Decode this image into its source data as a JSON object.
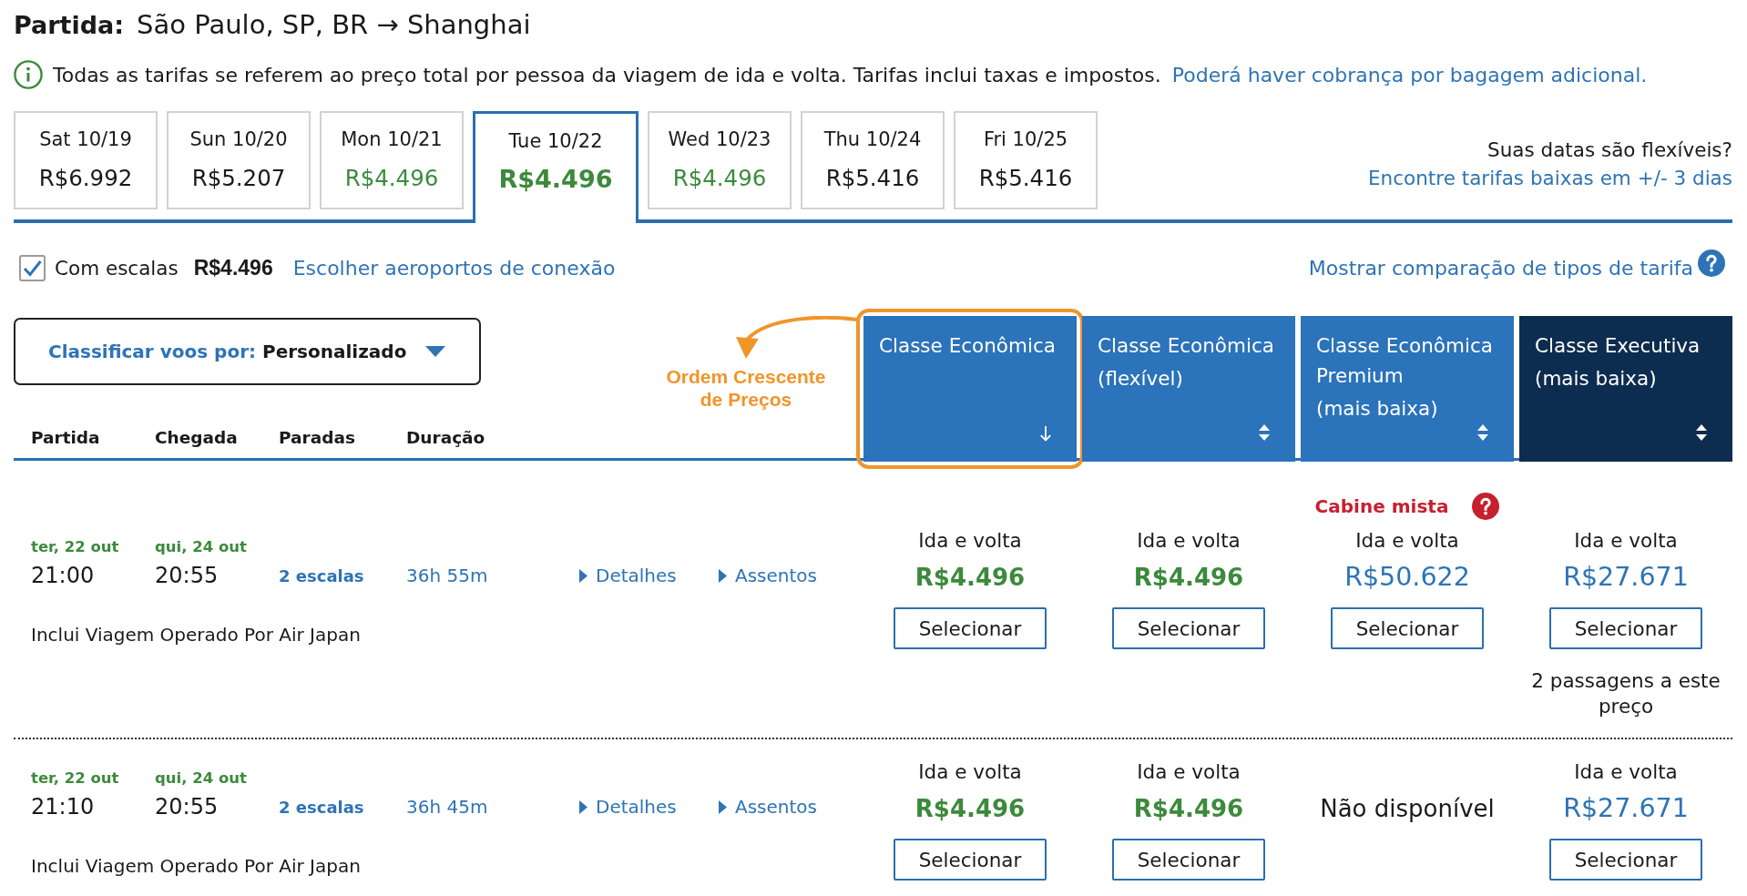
{
  "header": {
    "label": "Partida:",
    "route": "São Paulo, SP, BR → Shanghai"
  },
  "fare_notice": {
    "text": "Todas as tarifas se referem ao preço total por pessoa da viagem de ida e volta. Tarifas inclui taxas e impostos.",
    "link": "Poderá haver cobrança por bagagem adicional."
  },
  "date_tabs": [
    {
      "date": "Sat 10/19",
      "price": "R$6.992",
      "lowest_fare": false,
      "selected": false
    },
    {
      "date": "Sun 10/20",
      "price": "R$5.207",
      "lowest_fare": false,
      "selected": false
    },
    {
      "date": "Mon 10/21",
      "price": "R$4.496",
      "lowest_fare": true,
      "selected": false
    },
    {
      "date": "Tue 10/22",
      "price": "R$4.496",
      "lowest_fare": true,
      "selected": true
    },
    {
      "date": "Wed 10/23",
      "price": "R$4.496",
      "lowest_fare": true,
      "selected": false
    },
    {
      "date": "Thu 10/24",
      "price": "R$5.416",
      "lowest_fare": false,
      "selected": false
    },
    {
      "date": "Fri 10/25",
      "price": "R$5.416",
      "lowest_fare": false,
      "selected": false
    }
  ],
  "flexible_dates": {
    "question": "Suas datas são flexíveis?",
    "link": "Encontre tarifas baixas em +/- 3 dias"
  },
  "connections": {
    "label": "Com escalas",
    "checked": true,
    "price": "R$4.496",
    "link": "Escolher aeroportos de conexão"
  },
  "fare_comparison": {
    "link": "Mostrar comparação de tipos de tarifa"
  },
  "sort": {
    "label": "Classificar voos por:",
    "value": "Personalizado"
  },
  "annotation": {
    "text": "Ordem Crescente de Preços"
  },
  "table": {
    "columns": [
      "Partida",
      "Chegada",
      "Paradas",
      "Duração"
    ],
    "fare_columns": [
      {
        "title": "Classe Econômica",
        "kind": "economy",
        "sorted": true,
        "highlighted": true
      },
      {
        "title": "Classe Econômica",
        "subtitle": "(flexível)",
        "kind": "economy",
        "sorted": false,
        "highlighted": false
      },
      {
        "title": "Classe Econômica Premium",
        "subtitle": "(mais baixa)",
        "kind": "economy",
        "sorted": false,
        "highlighted": false
      },
      {
        "title": "Classe Executiva",
        "subtitle": "(mais baixa)",
        "kind": "business",
        "sorted": false,
        "highlighted": false
      }
    ],
    "rows": [
      {
        "departure": {
          "date": "ter, 22 out",
          "time": "21:00"
        },
        "arrival": {
          "date": "qui, 24 out",
          "time": "20:55"
        },
        "stops": "2 escalas",
        "duration": "36h 55m",
        "links": [
          "Detalhes",
          "Assentos"
        ],
        "operator": "Inclui Viagem Operado Por Air Japan",
        "fares": [
          {
            "kind": "price",
            "label": "Ida e volta",
            "price": "R$4.496",
            "lowest_fare": true,
            "button": "Selecionar"
          },
          {
            "kind": "price",
            "label": "Ida e volta",
            "price": "R$4.496",
            "lowest_fare": true,
            "button": "Selecionar"
          },
          {
            "kind": "price",
            "badge": "Cabine mista",
            "label": "Ida e volta",
            "price": "R$50.622",
            "lowest_fare": false,
            "button": "Selecionar"
          },
          {
            "kind": "price",
            "label": "Ida e volta",
            "price": "R$27.671",
            "lowest_fare": false,
            "button": "Selecionar",
            "note": "2 passagens a este preço"
          }
        ]
      },
      {
        "departure": {
          "date": "ter, 22 out",
          "time": "21:10"
        },
        "arrival": {
          "date": "qui, 24 out",
          "time": "20:55"
        },
        "stops": "2 escalas",
        "duration": "36h 45m",
        "links": [
          "Detalhes",
          "Assentos"
        ],
        "operator": "Inclui Viagem Operado Por Air Japan",
        "fares": [
          {
            "kind": "price",
            "label": "Ida e volta",
            "price": "R$4.496",
            "lowest_fare": true,
            "button": "Selecionar"
          },
          {
            "kind": "price",
            "label": "Ida e volta",
            "price": "R$4.496",
            "lowest_fare": true,
            "button": "Selecionar"
          },
          {
            "kind": "unavailable",
            "text": "Não disponível"
          },
          {
            "kind": "price",
            "label": "Ida e volta",
            "price": "R$27.671",
            "lowest_fare": false,
            "button": "Selecionar"
          }
        ]
      }
    ]
  }
}
